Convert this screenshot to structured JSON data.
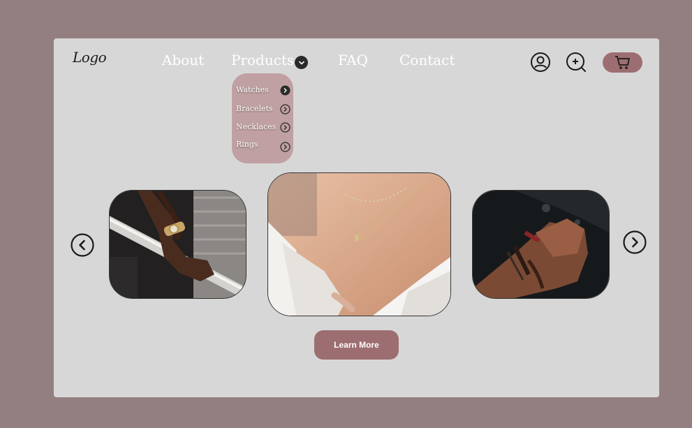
{
  "header": {
    "logo": "Logo",
    "nav": {
      "about": "About",
      "products": "Products",
      "faq": "FAQ",
      "contact": "Contact"
    }
  },
  "dropdown": {
    "items": [
      "Watches",
      "Bracelets",
      "Necklaces",
      "Rings"
    ]
  },
  "icons": {
    "account": "user-circle-icon",
    "zoom": "zoom-in-icon",
    "cart": "cart-icon",
    "prev": "chevron-left-icon",
    "next": "chevron-right-icon",
    "products_toggle": "chevron-down-icon"
  },
  "hero": {
    "cta": "Learn More"
  },
  "colors": {
    "page_bg": "#947f80",
    "card_bg": "#d8d7d7",
    "accent": "#9d6e71",
    "dropdown_bg": "#c0a0a2"
  }
}
